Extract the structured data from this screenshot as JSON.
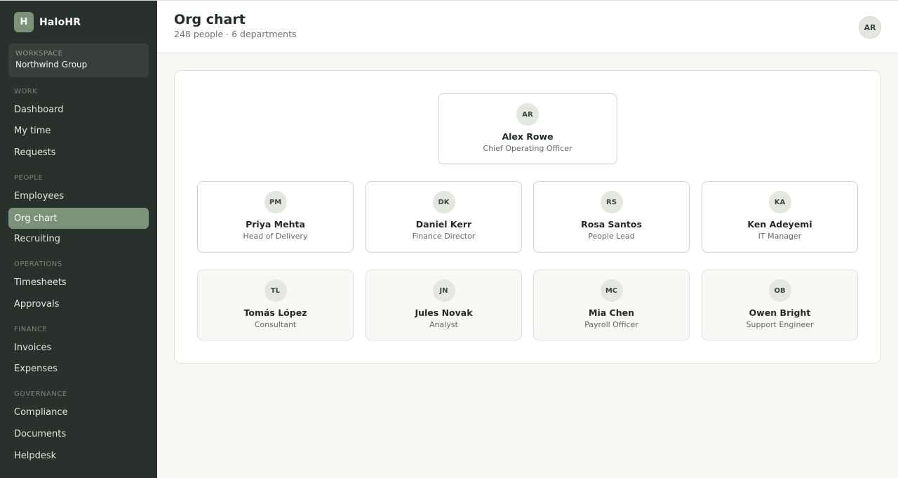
{
  "app": {
    "logo_letter": "H",
    "name": "HaloHR"
  },
  "workspace": {
    "label": "WORKSPACE",
    "name": "Northwind Group"
  },
  "sidebar": {
    "sections": [
      {
        "label": "WORK",
        "items": [
          "Dashboard",
          "My time",
          "Requests"
        ]
      },
      {
        "label": "PEOPLE",
        "items": [
          "Employees",
          "Org chart",
          "Recruiting"
        ]
      },
      {
        "label": "OPERATIONS",
        "items": [
          "Timesheets",
          "Approvals"
        ]
      },
      {
        "label": "FINANCE",
        "items": [
          "Invoices",
          "Expenses"
        ]
      },
      {
        "label": "GOVERNANCE",
        "items": [
          "Compliance",
          "Documents",
          "Helpdesk"
        ]
      }
    ],
    "active_item": "Org chart"
  },
  "header": {
    "title": "Org chart",
    "subtitle": "248 people · 6 departments",
    "user_initials": "AR"
  },
  "org": {
    "root": {
      "initials": "AR",
      "name": "Alex Rowe",
      "role": "Chief Operating Officer"
    },
    "level1": [
      {
        "initials": "PM",
        "name": "Priya Mehta",
        "role": "Head of Delivery"
      },
      {
        "initials": "DK",
        "name": "Daniel Kerr",
        "role": "Finance Director"
      },
      {
        "initials": "RS",
        "name": "Rosa Santos",
        "role": "People Lead"
      },
      {
        "initials": "KA",
        "name": "Ken Adeyemi",
        "role": "IT Manager"
      }
    ],
    "level2": [
      {
        "initials": "TL",
        "name": "Tomás López",
        "role": "Consultant"
      },
      {
        "initials": "JN",
        "name": "Jules Novak",
        "role": "Analyst"
      },
      {
        "initials": "MC",
        "name": "Mia Chen",
        "role": "Payroll Officer"
      },
      {
        "initials": "OB",
        "name": "Owen Bright",
        "role": "Support Engineer"
      }
    ]
  },
  "colors": {
    "sidebar_bg": "#26322b",
    "accent": "#7b9279",
    "avatar_bg": "#e4e7de"
  }
}
